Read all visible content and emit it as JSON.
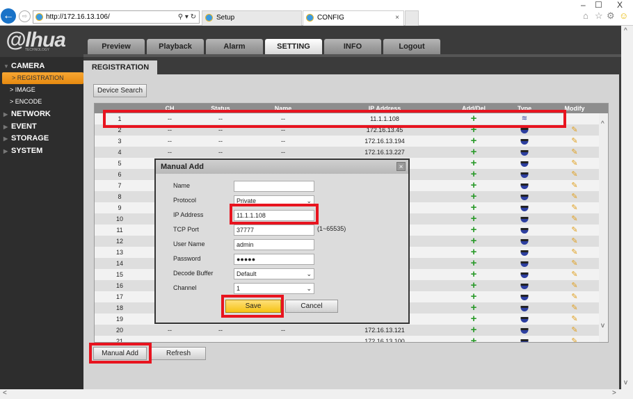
{
  "browser": {
    "url": "http://172.16.13.106/",
    "tabs": [
      {
        "label": "Setup"
      },
      {
        "label": "CONFIG"
      }
    ],
    "window_controls": {
      "minimize": "–",
      "maximize": "☐",
      "close": "X"
    }
  },
  "header": {
    "logo": "alhua",
    "logo_sub": "TECHNOLOGY",
    "nav": [
      {
        "label": "Preview"
      },
      {
        "label": "Playback"
      },
      {
        "label": "Alarm"
      },
      {
        "label": "SETTING",
        "active": true
      },
      {
        "label": "INFO"
      },
      {
        "label": "Logout"
      }
    ]
  },
  "sidebar": {
    "camera": "CAMERA",
    "camera_items": [
      {
        "label": "REGISTRATION",
        "selected": true
      },
      {
        "label": "IMAGE"
      },
      {
        "label": "ENCODE"
      }
    ],
    "sections": [
      {
        "label": "NETWORK"
      },
      {
        "label": "EVENT"
      },
      {
        "label": "STORAGE"
      },
      {
        "label": "SYSTEM"
      }
    ]
  },
  "page": {
    "tab": "REGISTRATION",
    "device_search": "Device Search",
    "manual_add": "Manual Add",
    "refresh": "Refresh"
  },
  "table": {
    "headers": [
      "",
      "CH",
      "Status",
      "Name",
      "IP Address",
      "Add/Del",
      "Type",
      "Modify"
    ],
    "rows": [
      {
        "no": "1",
        "ch": "--",
        "status": "--",
        "name": "--",
        "ip": "11.1.1.108",
        "type": "wifi",
        "modify": false
      },
      {
        "no": "2",
        "ch": "--",
        "status": "--",
        "name": "--",
        "ip": "172.16.13.45",
        "type": "camera",
        "modify": true
      },
      {
        "no": "3",
        "ch": "--",
        "status": "--",
        "name": "--",
        "ip": "172.16.13.194",
        "type": "camera",
        "modify": true
      },
      {
        "no": "4",
        "ch": "--",
        "status": "--",
        "name": "--",
        "ip": "172.16.13.227",
        "type": "camera",
        "modify": true
      },
      {
        "no": "5",
        "type": "camera",
        "modify": true
      },
      {
        "no": "6",
        "type": "camera",
        "modify": true
      },
      {
        "no": "7",
        "type": "camera",
        "modify": true
      },
      {
        "no": "8",
        "type": "camera",
        "modify": true
      },
      {
        "no": "9",
        "type": "camera",
        "modify": true
      },
      {
        "no": "10",
        "type": "camera",
        "modify": true
      },
      {
        "no": "11",
        "type": "camera",
        "modify": true
      },
      {
        "no": "12",
        "type": "camera",
        "modify": true
      },
      {
        "no": "13",
        "type": "camera",
        "modify": true
      },
      {
        "no": "14",
        "type": "camera",
        "modify": true
      },
      {
        "no": "15",
        "type": "camera",
        "modify": true
      },
      {
        "no": "16",
        "type": "camera",
        "modify": true
      },
      {
        "no": "17",
        "type": "camera",
        "modify": true
      },
      {
        "no": "18",
        "type": "camera",
        "modify": true
      },
      {
        "no": "19",
        "type": "camera",
        "modify": true
      },
      {
        "no": "20",
        "ch": "--",
        "status": "--",
        "name": "--",
        "ip": "172.16.13.121",
        "type": "camera",
        "modify": true
      },
      {
        "no": "21",
        "ch": "",
        "status": "",
        "name": "",
        "ip": "172.16.13.100",
        "type": "camera",
        "modify": true
      }
    ]
  },
  "dialog": {
    "title": "Manual Add",
    "fields": [
      {
        "label": "Name",
        "value": "",
        "kind": "text"
      },
      {
        "label": "Protocol",
        "value": "Private",
        "kind": "select"
      },
      {
        "label": "IP Address",
        "value": "11.1.1.108",
        "kind": "text"
      },
      {
        "label": "TCP Port",
        "value": "37777",
        "kind": "text"
      },
      {
        "label": "User Name",
        "value": "admin",
        "kind": "text"
      },
      {
        "label": "Password",
        "value": "●●●●●",
        "kind": "password"
      },
      {
        "label": "Decode Buffer",
        "value": "Default",
        "kind": "select"
      },
      {
        "label": "Channel",
        "value": "1",
        "kind": "select"
      }
    ],
    "port_hint": "(1~65535)",
    "save": "Save",
    "cancel": "Cancel"
  },
  "colors": {
    "highlight": "#e8141f",
    "accent": "#f5a623",
    "save": "#f5c314"
  }
}
